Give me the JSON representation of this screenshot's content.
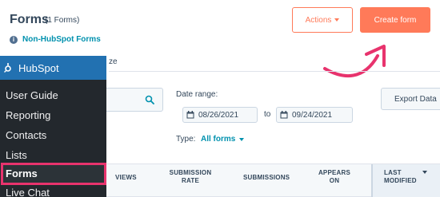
{
  "header": {
    "title": "Forms",
    "count": "(1 Forms)",
    "info_link": "Non-HubSpot Forms",
    "actions_label": "Actions",
    "create_label": "Create form"
  },
  "partial_text": "ze",
  "filters": {
    "date_range_label": "Date range:",
    "date_from": "08/26/2021",
    "to_label": "to",
    "date_to": "09/24/2021",
    "export_label": "Export Data",
    "type_label": "Type:",
    "type_value": "All forms"
  },
  "table": {
    "columns": [
      "VIEWS",
      "SUBMISSION RATE",
      "SUBMISSIONS",
      "APPEARS ON",
      "LAST MODIFIED"
    ]
  },
  "sidebar": {
    "brand": "HubSpot",
    "items": [
      {
        "label": "User Guide"
      },
      {
        "label": "Reporting"
      },
      {
        "label": "Contacts"
      },
      {
        "label": "Lists"
      },
      {
        "label": "Forms"
      },
      {
        "label": "Live Chat"
      }
    ]
  },
  "colors": {
    "accent": "#ff7a59",
    "link": "#0091ae",
    "sidebar_bg": "#23282d",
    "sidebar_brand": "#2271b1",
    "highlight": "#e8336d"
  },
  "icons": [
    "info-icon",
    "caret-down-icon",
    "search-icon",
    "calendar-icon",
    "hubspot-sprocket-icon",
    "arrow-annotation"
  ]
}
